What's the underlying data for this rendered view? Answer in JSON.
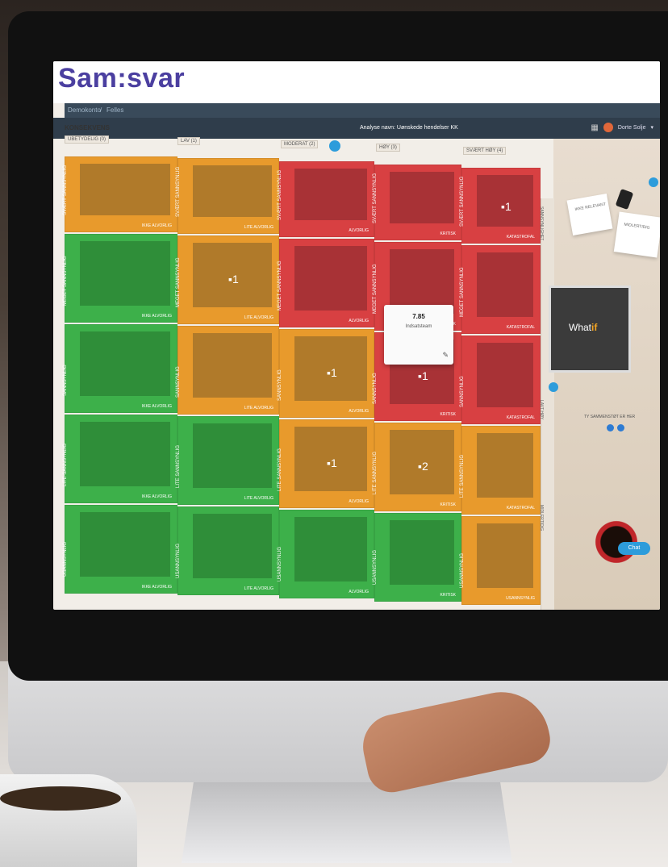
{
  "app": {
    "logo": "Sam:svar",
    "breadcrumb": [
      "Demokonto",
      "/",
      "Felles"
    ],
    "screen_title": "Analyse navn: Uønskede hendelser KK",
    "user_name": "Dorte Solje"
  },
  "matrix": {
    "axis_title": "KONSEKVENS",
    "consequence_headers": [
      "UBETYDELIG (0)",
      "LAV (1)",
      "MODERAT (2)",
      "HØY (3)",
      "SVÆRT HØY (4)"
    ],
    "side_labels": [
      "SANNSYNLIGHET",
      "LAVT HØY",
      "MIDLERTIDIG"
    ],
    "rows": [
      {
        "likelihood": "SVÆRT SANNSYNLIG",
        "cells": [
          {
            "color": "orange",
            "severity": "IKKE ALVORLIG",
            "count": ""
          },
          {
            "color": "orange",
            "severity": "LITE ALVORLIG",
            "count": ""
          },
          {
            "color": "red",
            "severity": "ALVORLIG",
            "count": ""
          },
          {
            "color": "red",
            "severity": "KRITISK",
            "count": ""
          },
          {
            "color": "red",
            "severity": "KATASTROFAL",
            "count": "1"
          }
        ]
      },
      {
        "likelihood": "MEGET SANNSYNLIG",
        "cells": [
          {
            "color": "green",
            "severity": "IKKE ALVORLIG",
            "count": ""
          },
          {
            "color": "orange",
            "severity": "LITE ALVORLIG",
            "count": "1"
          },
          {
            "color": "red",
            "severity": "ALVORLIG",
            "count": ""
          },
          {
            "color": "red",
            "severity": "KRITISK",
            "count": ""
          },
          {
            "color": "red",
            "severity": "KATASTROFAL",
            "count": ""
          }
        ]
      },
      {
        "likelihood": "SANNSYNLIG",
        "cells": [
          {
            "color": "green",
            "severity": "IKKE ALVORLIG",
            "count": ""
          },
          {
            "color": "orange",
            "severity": "LITE ALVORLIG",
            "count": ""
          },
          {
            "color": "orange",
            "severity": "ALVORLIG",
            "count": "1"
          },
          {
            "color": "red",
            "severity": "KRITISK",
            "count": "1"
          },
          {
            "color": "red",
            "severity": "KATASTROFAL",
            "count": ""
          }
        ]
      },
      {
        "likelihood": "LITE SANNSYNLIG",
        "cells": [
          {
            "color": "green",
            "severity": "IKKE ALVORLIG",
            "count": ""
          },
          {
            "color": "green",
            "severity": "LITE ALVORLIG",
            "count": ""
          },
          {
            "color": "orange",
            "severity": "ALVORLIG",
            "count": "1"
          },
          {
            "color": "orange",
            "severity": "KRITISK",
            "count": "2"
          },
          {
            "color": "orange",
            "severity": "KATASTROFAL",
            "count": ""
          }
        ]
      },
      {
        "likelihood": "USANNSYNLIG",
        "cells": [
          {
            "color": "green",
            "severity": "IKKE ALVORLIG",
            "count": ""
          },
          {
            "color": "green",
            "severity": "LITE ALVORLIG",
            "count": ""
          },
          {
            "color": "green",
            "severity": "ALVORLIG",
            "count": ""
          },
          {
            "color": "green",
            "severity": "KRITISK",
            "count": ""
          },
          {
            "color": "orange",
            "severity": "USANNSYNLIG",
            "count": ""
          }
        ]
      }
    ]
  },
  "card": {
    "id": "7.85",
    "name": "Indsatsteam"
  },
  "side_panel": {
    "note_1": "IKKE RELEVANT",
    "note_2": "MIDLERTIDIG",
    "whatif_text": "What",
    "whatif_bold": "if",
    "hint": "TY SAMMENSTØT ER HER",
    "chat_label": "Chat"
  },
  "colors": {
    "orange": "#e89a2c",
    "red": "#d84042",
    "green": "#3db04a",
    "brand": "#4b3fa0",
    "accent": "#2d9cdb"
  }
}
